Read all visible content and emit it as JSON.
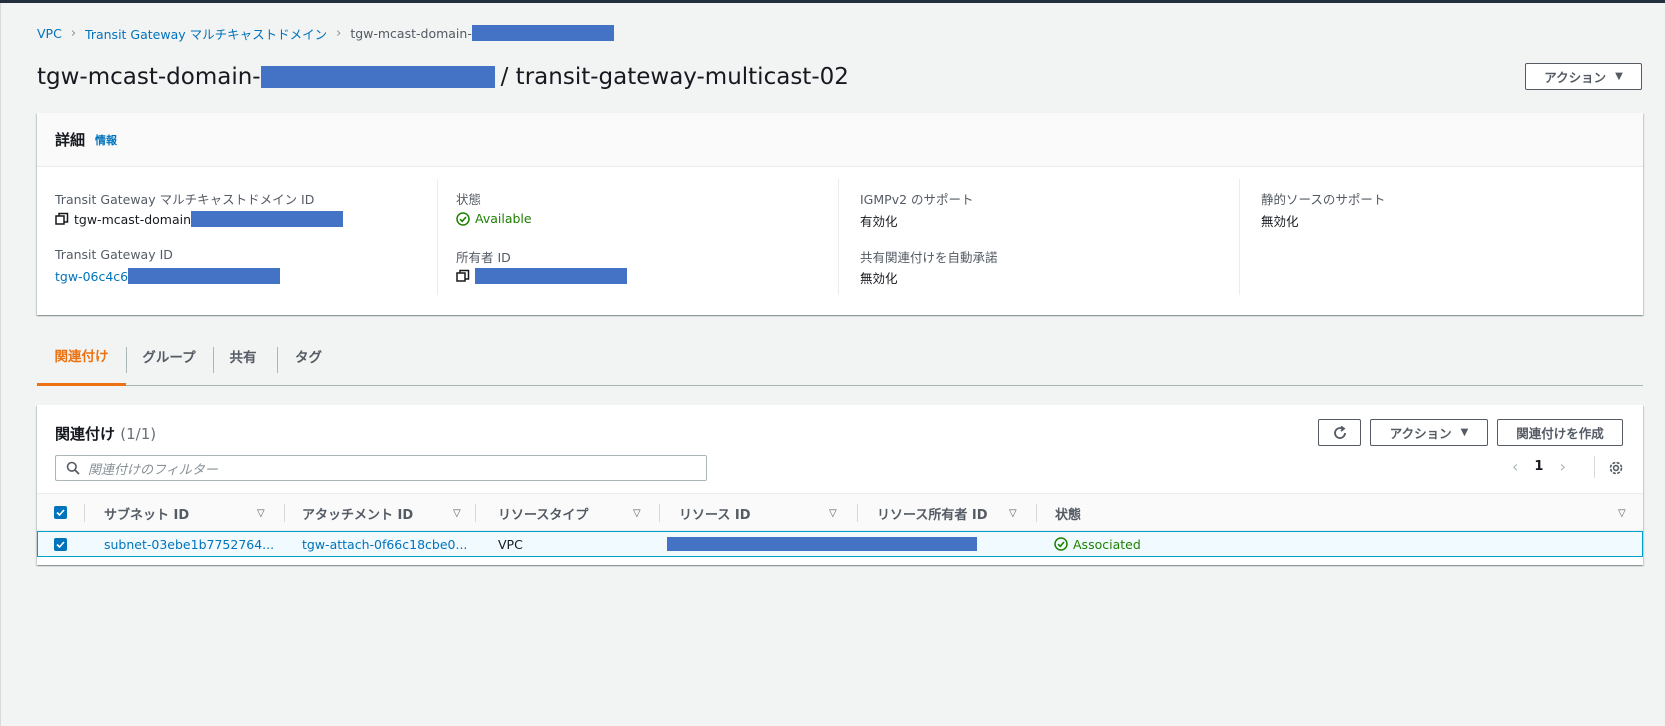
{
  "breadcrumb": {
    "items": [
      "VPC",
      "Transit Gateway マルチキャストドメイン"
    ],
    "current": "tgw-mcast-domain-"
  },
  "header": {
    "title_prefix": "tgw-mcast-domain-",
    "title_suffix": "/ transit-gateway-multicast-02",
    "actions_label": "アクション"
  },
  "details": {
    "title": "詳細",
    "info_label": "情報",
    "domain_id_label": "Transit Gateway マルチキャストドメイン ID",
    "domain_id_value": "tgw-mcast-domain",
    "tgw_id_label": "Transit Gateway ID",
    "tgw_id_value": "tgw-06c4c6",
    "state_label": "状態",
    "state_value": "Available",
    "owner_label": "所有者 ID",
    "igmp_label": "IGMPv2 のサポート",
    "igmp_value": "有効化",
    "auto_accept_label": "共有関連付けを自動承諾",
    "auto_accept_value": "無効化",
    "static_source_label": "静的ソースのサポート",
    "static_source_value": "無効化"
  },
  "tabs": [
    {
      "label": "関連付け",
      "active": true
    },
    {
      "label": "グループ",
      "active": false
    },
    {
      "label": "共有",
      "active": false
    },
    {
      "label": "タグ",
      "active": false
    }
  ],
  "associations": {
    "title": "関連付け",
    "count": "(1/1)",
    "actions_label": "アクション",
    "create_label": "関連付けを作成",
    "filter_placeholder": "関連付けのフィルター",
    "page": "1",
    "columns": [
      "サブネット ID",
      "アタッチメント ID",
      "リソースタイプ",
      "リソース ID",
      "リソース所有者 ID",
      "状態"
    ],
    "rows": [
      {
        "subnet_id": "subnet-03ebe1b7752764...",
        "attachment_id": "tgw-attach-0f66c18cbe0...",
        "resource_type": "VPC",
        "state": "Associated"
      }
    ]
  },
  "colors": {
    "link": "#0073bb",
    "success": "#1d8102",
    "accent": "#ec7211",
    "redaction": "#4472c4"
  }
}
